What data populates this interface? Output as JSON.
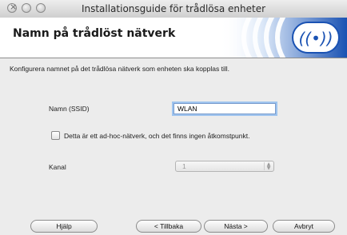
{
  "window": {
    "title": "Installationsguide för trådlösa enheter"
  },
  "header": {
    "title": "Namn på trådlöst nätverk",
    "logo_icon": "wireless-signal-icon",
    "accent": "#1a52b3"
  },
  "description": "Konfigurera namnet på det trådlösa nätverk som enheten ska kopplas till.",
  "ssid": {
    "label": "Namn (SSID)",
    "value": "WLAN"
  },
  "adhoc": {
    "label": "Detta är ett ad-hoc-nätverk, och det finns ingen åtkomstpunkt.",
    "checked": false
  },
  "channel": {
    "label": "Kanal",
    "value": "1",
    "enabled": false
  },
  "buttons": {
    "help": "Hjälp",
    "back": "< Tillbaka",
    "next": "Nästa >",
    "cancel": "Avbryt"
  }
}
